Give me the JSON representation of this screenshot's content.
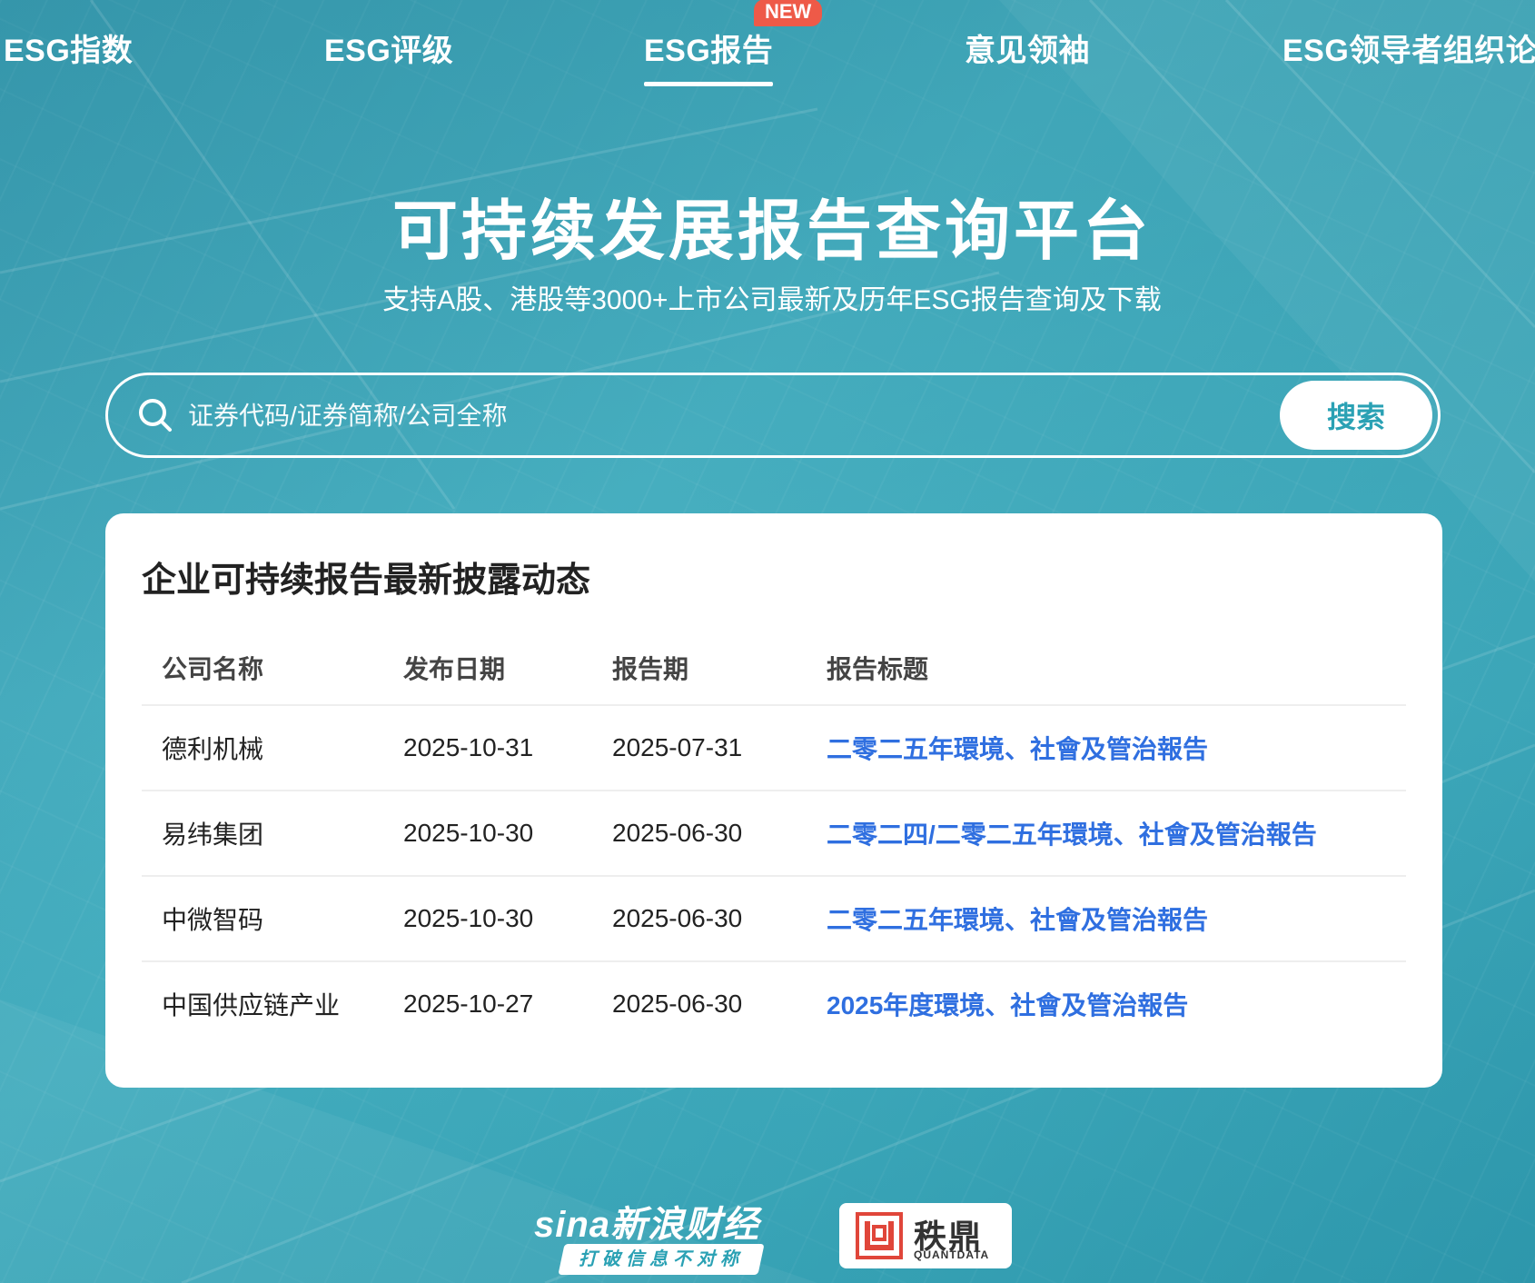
{
  "nav": {
    "items": [
      "ESG指数",
      "ESG评级",
      "ESG报告",
      "意见领袖",
      "ESG领导者组织论"
    ],
    "active_index": 2,
    "new_badge": "NEW"
  },
  "hero": {
    "title": "可持续发展报告查询平台",
    "subtitle": "支持A股、港股等3000+上市公司最新及历年ESG报告查询及下载"
  },
  "search": {
    "placeholder": "证券代码/证券简称/公司全称",
    "value": "",
    "button_label": "搜索",
    "icon": "search-icon"
  },
  "disclosures": {
    "title": "企业可持续报告最新披露动态",
    "columns": [
      "公司名称",
      "发布日期",
      "报告期",
      "报告标题"
    ],
    "rows": [
      [
        "德利机械",
        "2025-10-31",
        "2025-07-31",
        "二零二五年環境、社會及管治報告"
      ],
      [
        "易纬集团",
        "2025-10-30",
        "2025-06-30",
        "二零二四/二零二五年環境、社會及管治報告"
      ],
      [
        "中微智码",
        "2025-10-30",
        "2025-06-30",
        "二零二五年環境、社會及管治報告"
      ],
      [
        "中国供应链产业",
        "2025-10-27",
        "2025-06-30",
        "2025年度環境、社會及管治報告"
      ]
    ]
  },
  "footer": {
    "sina_name": "sina新浪财经",
    "sina_tagline": "打破信息不对称",
    "quantdata_name": "秩鼎",
    "quantdata_en": "QUANTDATA"
  },
  "colors": {
    "background": "#3aa5b4",
    "link": "#2f6fe0",
    "badge": "#ee5a48",
    "button_text": "#2aa1b4"
  }
}
